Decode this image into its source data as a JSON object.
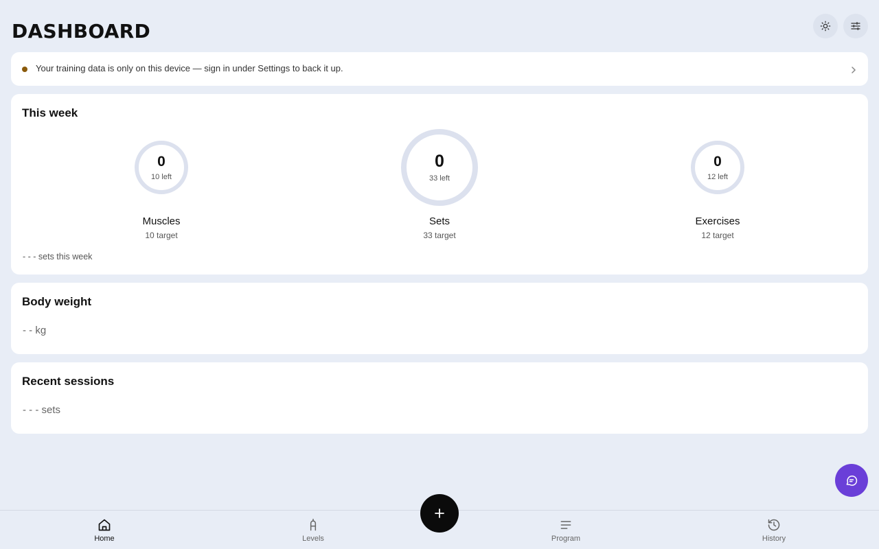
{
  "header": {
    "title": "DASHBOARD",
    "theme_icon": "sun-icon",
    "menu_icon": "sliders-icon"
  },
  "banner": {
    "text": "Your training data is only on this device — sign in under Settings to back it up.",
    "dot_color": "#8a5a0b"
  },
  "this_week": {
    "title": "This week",
    "stats": [
      {
        "value": "0",
        "left": "10 left",
        "name": "Muscles",
        "target": "10 target"
      },
      {
        "value": "0",
        "left": "33 left",
        "name": "Sets",
        "target": "33 target"
      },
      {
        "value": "0",
        "left": "12 left",
        "name": "Exercises",
        "target": "12 target"
      }
    ],
    "footer": "- - - sets this week"
  },
  "body_weight": {
    "title": "Body weight",
    "value": "- - kg"
  },
  "recent_sessions": {
    "title": "Recent sessions",
    "value": "- - - sets"
  },
  "nav": {
    "items": [
      {
        "label": "Home",
        "icon": "home-icon",
        "active": true
      },
      {
        "label": "Levels",
        "icon": "levels-icon",
        "active": false
      },
      {
        "label": "Program",
        "icon": "list-icon",
        "active": false
      },
      {
        "label": "History",
        "icon": "history-icon",
        "active": false
      }
    ],
    "add_icon": "plus-icon"
  },
  "chat": {
    "icon": "chat-icon",
    "color": "#6a3fd8"
  }
}
